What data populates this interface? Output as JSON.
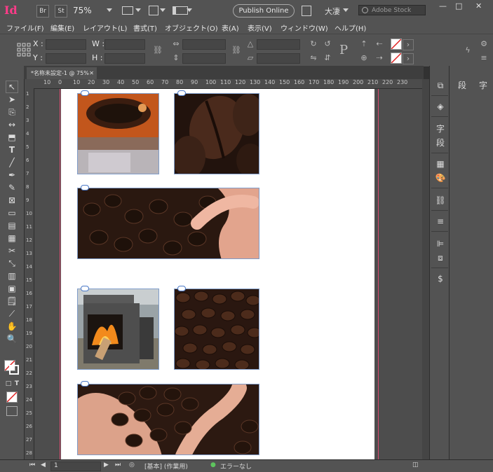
{
  "app": {
    "logo": "Id",
    "bridge_chip": "Br",
    "stock_chip": "St",
    "zoom": "75%",
    "publish_label": "Publish Online",
    "workspace_label": "大凄",
    "stock_search_placeholder": "Adobe Stock",
    "win_min": "—",
    "win_max": "□",
    "win_close": "✕"
  },
  "menu": [
    "ファイル(F)",
    "編集(E)",
    "レイアウト(L)",
    "書式(T)",
    "オブジェクト(O)",
    "表(A)",
    "表示(V)",
    "ウィンドウ(W)",
    "ヘルプ(H)"
  ],
  "control": {
    "x_label": "X :",
    "y_label": "Y :",
    "w_label": "W :",
    "h_label": "H :",
    "p_label": "P"
  },
  "document": {
    "tab_label": "*名称未設定-1 @ 75%",
    "tab_close": "✕"
  },
  "ruler": {
    "h_ticks": [
      "10",
      "0",
      "10",
      "20",
      "30",
      "40",
      "50",
      "60",
      "70",
      "80",
      "90",
      "100",
      "110",
      "120",
      "130",
      "140",
      "150",
      "160",
      "170",
      "180",
      "190",
      "200",
      "210",
      "220",
      "230"
    ],
    "v_ticks": [
      "1",
      "2",
      "3",
      "4",
      "5",
      "6",
      "7",
      "8",
      "9",
      "10",
      "11",
      "12",
      "13",
      "14",
      "15",
      "16",
      "17",
      "18",
      "19",
      "20",
      "21",
      "22",
      "23",
      "24",
      "25",
      "26",
      "27",
      "28"
    ]
  },
  "right_panel": {
    "char_label": "字",
    "para_label": "段"
  },
  "status": {
    "page_number": "1",
    "style_label": "[基本] (作業用)",
    "preflight": "エラーなし"
  },
  "colors": {
    "accent": "#ff3b89",
    "frame": "#7f9cc9",
    "bleed": "#d94a70"
  },
  "icons": {
    "select": "selection-arrow-icon",
    "hand": "hand-icon",
    "zoom": "zoom-icon"
  }
}
